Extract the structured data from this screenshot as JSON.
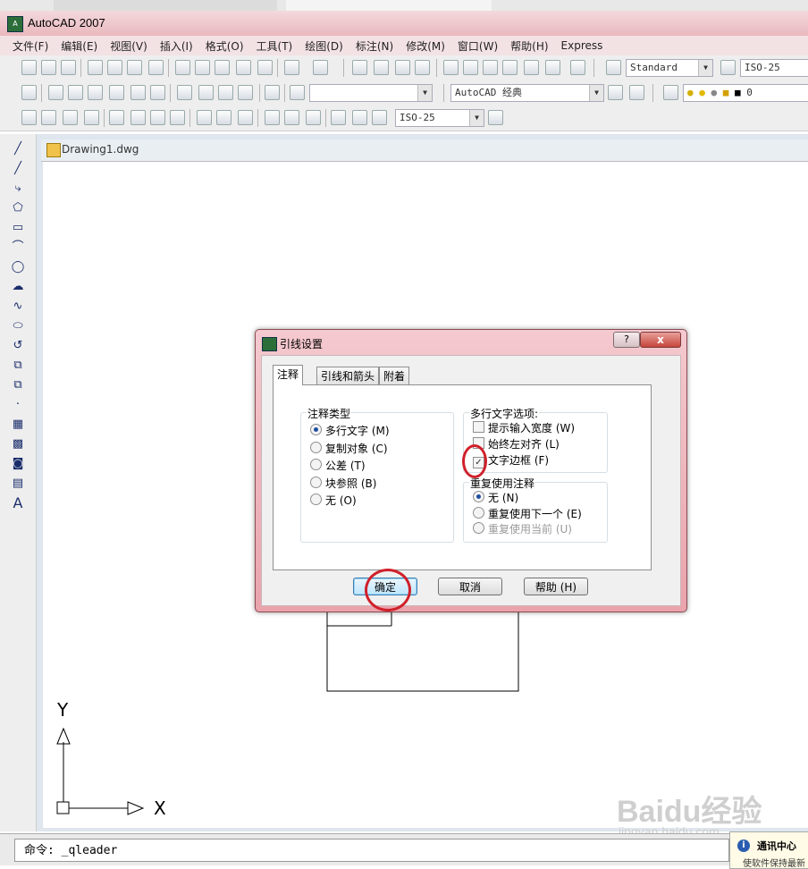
{
  "app": {
    "title": "AutoCAD 2007"
  },
  "menu": [
    "文件(F)",
    "编辑(E)",
    "视图(V)",
    "插入(I)",
    "格式(O)",
    "工具(T)",
    "绘图(D)",
    "标注(N)",
    "修改(M)",
    "窗口(W)",
    "帮助(H)",
    "Express"
  ],
  "toolbar": {
    "text_style": "Standard",
    "dim_style": "ISO-25",
    "workspace": "AutoCAD 经典",
    "layer_name": "0",
    "dim_style_2": "ISO-25"
  },
  "drawing": {
    "tab_label": "Drawing1.dwg",
    "ucs_x": "X",
    "ucs_y": "Y"
  },
  "dialog": {
    "title": "引线设置",
    "help_glyph": "?",
    "close_glyph": "x",
    "tabs": [
      "注释",
      "引线和箭头",
      "附着"
    ],
    "annotation_type": {
      "legend": "注释类型",
      "options": [
        {
          "label": "多行文字 (M)",
          "selected": true
        },
        {
          "label": "复制对象 (C)",
          "selected": false
        },
        {
          "label": "公差 (T)",
          "selected": false
        },
        {
          "label": "块参照 (B)",
          "selected": false
        },
        {
          "label": "无 (O)",
          "selected": false
        }
      ]
    },
    "mtext_options": {
      "legend": "多行文字选项:",
      "options": [
        {
          "label": "提示输入宽度 (W)",
          "checked": false
        },
        {
          "label": "始终左对齐 (L)",
          "checked": false
        },
        {
          "label": "文字边框 (F)",
          "checked": true
        }
      ]
    },
    "reuse": {
      "legend": "重复使用注释",
      "options": [
        {
          "label": "无 (N)",
          "selected": true,
          "disabled": false
        },
        {
          "label": "重复使用下一个 (E)",
          "selected": false,
          "disabled": false
        },
        {
          "label": "重复使用当前 (U)",
          "selected": false,
          "disabled": true
        }
      ]
    },
    "buttons": {
      "ok": "确定",
      "cancel": "取消",
      "help": "帮助 (H)"
    }
  },
  "command_line": {
    "text": "命令: _qleader"
  },
  "comm_center": {
    "title": "通讯中心",
    "text": "使软件保持最新"
  },
  "watermark": {
    "main": "Baidu经验",
    "sub": "jingyan.baidu.com"
  },
  "colors": {
    "title_bar": "#e9b8be",
    "highlight_circle": "#d0202a",
    "dialog_frame": "#eaa3ac"
  }
}
